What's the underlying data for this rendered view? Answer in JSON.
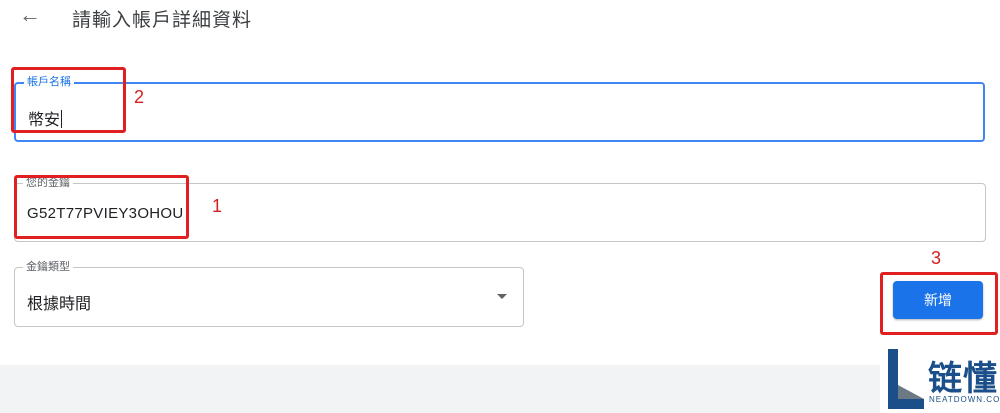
{
  "header": {
    "back_icon": "arrow-left-icon",
    "title": "請輸入帳戶詳細資料"
  },
  "form": {
    "account_name": {
      "label": "帳戶名稱",
      "value": "幣安"
    },
    "your_key": {
      "label": "您的金鑰",
      "value": "G52T77PVIEY3OHOU"
    },
    "key_type": {
      "label": "金鑰類型",
      "value": "根據時間"
    }
  },
  "actions": {
    "add_label": "新增"
  },
  "annotations": [
    "2",
    "1",
    "3"
  ],
  "watermark": {
    "text": "链懂",
    "sub": "NEATDOWN.COM"
  },
  "colors": {
    "accent": "#1a73e8",
    "focus_border": "#4285f4",
    "annotation_red": "#e02020",
    "watermark_blue": "#1a4f8a"
  }
}
